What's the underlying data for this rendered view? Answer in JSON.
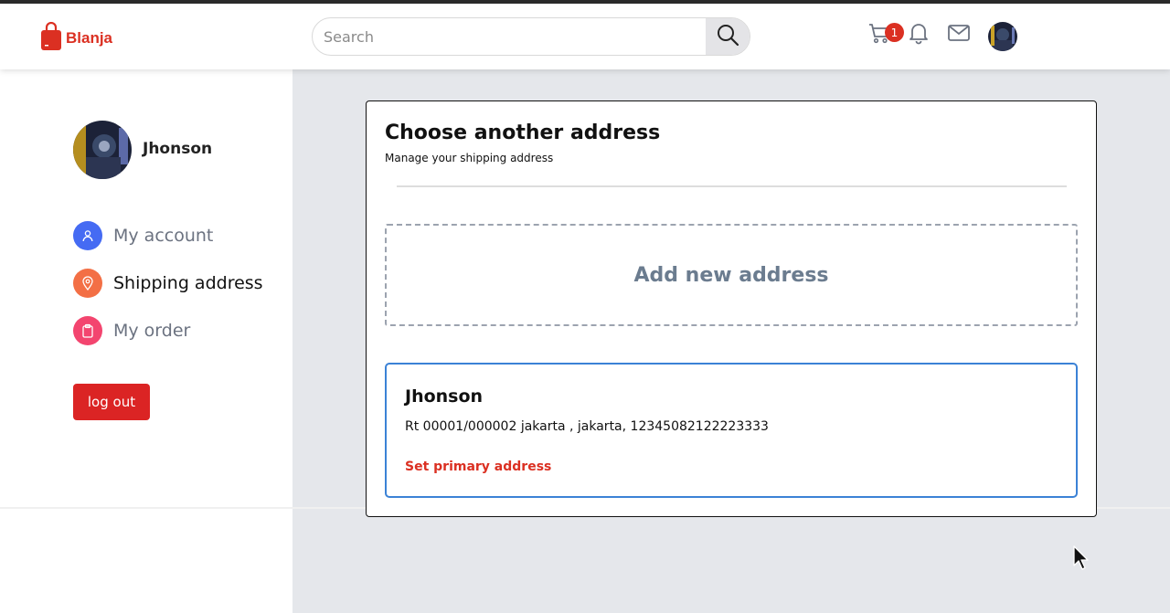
{
  "brand": {
    "name": "Blanja",
    "color": "#db3022"
  },
  "search": {
    "placeholder": "Search"
  },
  "header": {
    "cart_count": "1",
    "icons": [
      "cart-icon",
      "bell-icon",
      "mail-icon"
    ]
  },
  "sidebar": {
    "user_name": "Jhonson",
    "items": [
      {
        "label": "My account",
        "icon": "user-icon",
        "color": "#456bf3",
        "active": false
      },
      {
        "label": "Shipping address",
        "icon": "map-pin-icon",
        "color": "#f36f45",
        "active": true
      },
      {
        "label": "My order",
        "icon": "clipboard-icon",
        "color": "#f3456f",
        "active": false
      }
    ],
    "logout_label": "log out"
  },
  "modal": {
    "title": "Choose another address",
    "subtitle": "Manage your shipping address",
    "add_label": "Add new address",
    "addresses": [
      {
        "name": "Jhonson",
        "detail": "Rt 00001/000002 jakarta , jakarta, 12345082122223333",
        "action": "Set primary address"
      }
    ]
  },
  "colors": {
    "accent": "#db3022",
    "card_border": "#3b82d6",
    "main_bg": "#e5e7eb"
  }
}
